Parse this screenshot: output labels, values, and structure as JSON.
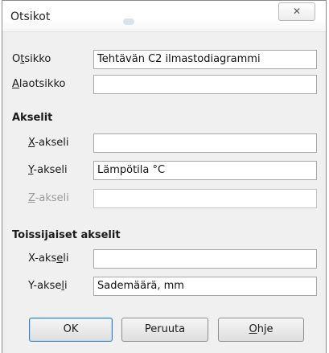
{
  "window": {
    "title": "Otsikot",
    "close_glyph": "✕",
    "close_icon": "close-icon"
  },
  "titles": {
    "title_label_pre": "O",
    "title_label_u": "t",
    "title_label_post": "sikko",
    "title_value": "Tehtävän C2 ilmastodiagrammi",
    "subtitle_label_pre": "",
    "subtitle_label_u": "A",
    "subtitle_label_post": "laotsikko",
    "subtitle_value": ""
  },
  "axes": {
    "heading": "Akselit",
    "x_label_pre": "",
    "x_label_u": "X",
    "x_label_post": "-akseli",
    "x_value": "",
    "y_label_pre": "",
    "y_label_u": "Y",
    "y_label_post": "-akseli",
    "y_value": "Lämpötila °C",
    "z_label_pre": "",
    "z_label_u": "Z",
    "z_label_post": "-akseli",
    "z_value": ""
  },
  "secondary_axes": {
    "heading": "Toissijaiset akselit",
    "x_label_pre": "X-aks",
    "x_label_u": "e",
    "x_label_post": "li",
    "x_value": "",
    "y_label_pre": "Y-akse",
    "y_label_u": "l",
    "y_label_post": "i",
    "y_value": "Sademäärä, mm"
  },
  "buttons": {
    "ok": "OK",
    "cancel": "Peruuta",
    "help_u": "O",
    "help_post": "hje"
  }
}
